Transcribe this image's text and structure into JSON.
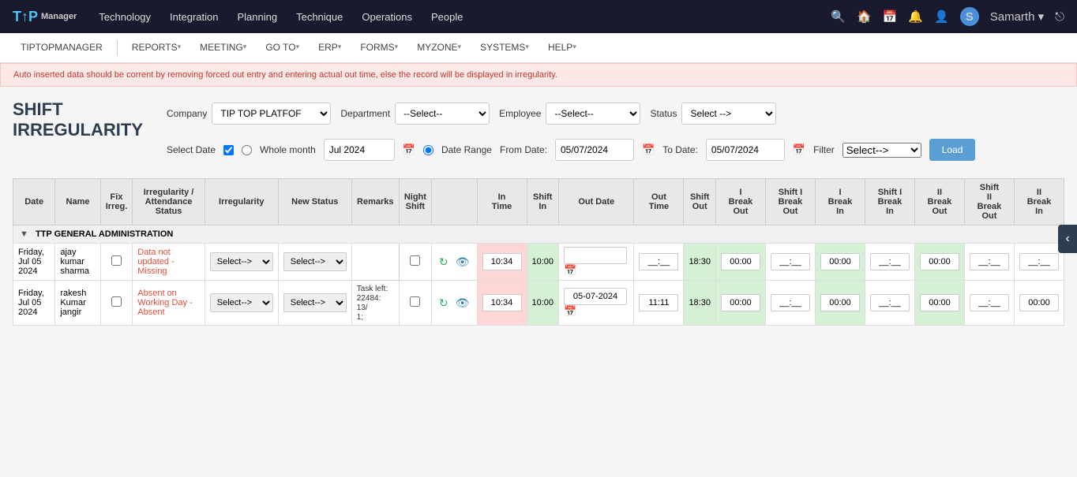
{
  "topNav": {
    "logo": "T↑P",
    "logoSub": "Manager",
    "links": [
      "Technology",
      "Integration",
      "Planning",
      "Technique",
      "Operations",
      "People"
    ],
    "searchIcon": "🔍",
    "homeIcon": "🏠",
    "calIcon": "📅",
    "bellIcon": "🔔",
    "userIcon": "👤",
    "userName": "Samarth",
    "dropArrow": "▾",
    "logoutIcon": "↩"
  },
  "secondNav": {
    "items": [
      {
        "label": "TIPTOPMANAGER",
        "active": false
      },
      {
        "label": "REPORTS",
        "dropdown": true
      },
      {
        "label": "MEETING",
        "dropdown": true
      },
      {
        "label": "GO TO",
        "dropdown": true
      },
      {
        "label": "ERP",
        "dropdown": true
      },
      {
        "label": "FORMS",
        "dropdown": true
      },
      {
        "label": "MYZONE",
        "dropdown": true
      },
      {
        "label": "SYSTEMS",
        "dropdown": true
      },
      {
        "label": "HELP",
        "dropdown": true
      }
    ]
  },
  "alert": {
    "text": "Auto inserted data should be corrent by removing forced out entry and entering actual out time, else the record will be displayed in irregularity."
  },
  "pageTitle": "Shift\nIrregularity",
  "filters": {
    "companyLabel": "Company",
    "companyValue": "TIP TOP PLATFOF",
    "departmentLabel": "Department",
    "departmentPlaceholder": "--Select--",
    "employeeLabel": "Employee",
    "employeePlaceholder": "--Select--",
    "statusLabel": "Status",
    "statusPlaceholder": "Select -->"
  },
  "dateFilters": {
    "selectDateLabel": "Select Date",
    "wholeMonthLabel": "Whole month",
    "dateValue": "Jul 2024",
    "dateRangeLabel": "Date Range",
    "fromDateLabel": "From Date:",
    "fromDateValue": "05/07/2024",
    "toDateLabel": "To Date:",
    "toDateValue": "05/07/2024",
    "filterLabel": "Filter",
    "filterPlaceholder": "Select-->",
    "loadButton": "Load"
  },
  "tableHeaders": [
    "Date",
    "Name",
    "Fix Irreg.",
    "Irregularity / Attendance Status",
    "Irregularity",
    "New Status",
    "Remarks",
    "Night Shift",
    "",
    "In Time",
    "Shift In",
    "Out Date",
    "Out Time",
    "Shift Out",
    "I Break Out",
    "Shift I Break Out",
    "I Break In",
    "Shift I Break In",
    "II Break Out",
    "Shift II Break Out",
    "II Break In"
  ],
  "groupHeader": "TTP GENERAL ADMINISTRATION",
  "rows": [
    {
      "date": "Friday, Jul 05 2024",
      "name": "ajay kumar sharma",
      "fixIrreg": false,
      "irregStatus": "Data not updated - Missing",
      "irregStatusColor": "red",
      "irregularity": "Select-->",
      "newStatus": "Select-->",
      "remarks": "",
      "nightShift": false,
      "inTime": "10:34",
      "inTimePink": true,
      "shiftIn": "10:00",
      "outDate": "",
      "outDateEmpty": true,
      "outTime": "__:__",
      "shiftOut": "18:30",
      "iBreakOut": "00:00",
      "shiftIBreakOut": "__:__",
      "iBreakIn": "00:00",
      "shiftIBreakIn": "__:__",
      "iiBreakOut": "00:00",
      "shiftIIBreakOut": "__:__",
      "iiBreakIn": "__:__"
    },
    {
      "date": "Friday, Jul 05 2024",
      "name": "rakesh Kumar jangir",
      "fixIrreg": false,
      "irregStatus": "Absent on Working Day - Absent",
      "irregStatusColor": "red",
      "irregularity": "Select-->",
      "newStatus": "Select-->",
      "remarks": "Task left: 22484: 13/1;",
      "nightShift": false,
      "inTime": "10:34",
      "inTimePink": true,
      "shiftIn": "10:00",
      "outDate": "05-07-2024",
      "outDateEmpty": false,
      "outTime": "11:11",
      "shiftOut": "18:30",
      "iBreakOut": "00:00",
      "shiftIBreakOut": "__:__",
      "iBreakIn": "00:00",
      "shiftIBreakIn": "__:__",
      "iiBreakOut": "00:00",
      "shiftIIBreakOut": "__:__",
      "iiBreakIn": "00:00"
    }
  ]
}
